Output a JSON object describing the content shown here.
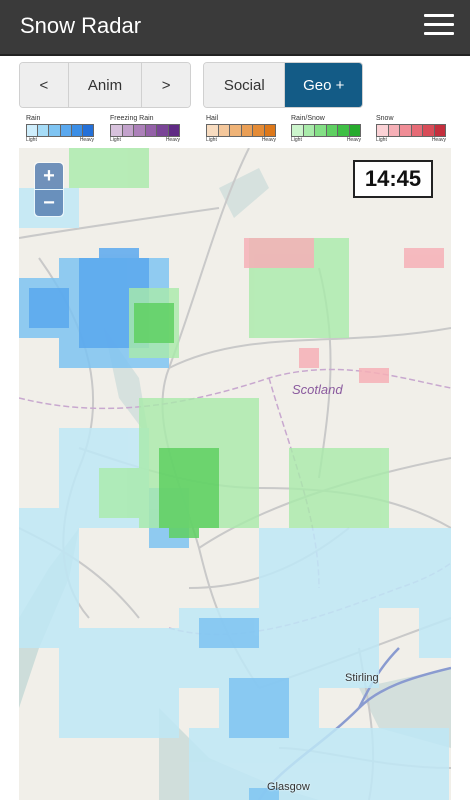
{
  "app": {
    "title": "Snow Radar"
  },
  "controls": {
    "prev_label": "<",
    "anim_label": "Anim",
    "next_label": ">",
    "social_label": "Social",
    "geo_label": "Geo +"
  },
  "legend": [
    {
      "name": "Rain",
      "light": "Light",
      "heavy": "Heavy",
      "colors": [
        "#cfeefc",
        "#a6dcf7",
        "#7fc4f2",
        "#5aa8ee",
        "#3b8ee6",
        "#2470d8"
      ]
    },
    {
      "name": "Freezing Rain",
      "light": "Light",
      "heavy": "Heavy",
      "colors": [
        "#d8c2dd",
        "#c3a2cc",
        "#ac80b9",
        "#9461a8",
        "#7a4597",
        "#5f2a84"
      ]
    },
    {
      "name": "Hail",
      "light": "Light",
      "heavy": "Heavy",
      "colors": [
        "#f8dcc0",
        "#f4c79b",
        "#efb377",
        "#ea9f56",
        "#e48b36",
        "#dd781a"
      ]
    },
    {
      "name": "Rain/Snow",
      "light": "Light",
      "heavy": "Heavy",
      "colors": [
        "#ccf5cc",
        "#a9ebaa",
        "#84df86",
        "#5fd062",
        "#3fbf45",
        "#27ab2d"
      ]
    },
    {
      "name": "Snow",
      "light": "Light",
      "heavy": "Heavy",
      "colors": [
        "#fbd2d6",
        "#f6b0b7",
        "#f08d96",
        "#e66b76",
        "#d84c58",
        "#c42f3d"
      ]
    }
  ],
  "map": {
    "zoom_in": "+",
    "zoom_out": "−",
    "time": "14:45",
    "region_label": "Scotland",
    "places": [
      "Stirling",
      "Glasgow"
    ],
    "colors": {
      "land": "#f1efe9",
      "roads": "#c9c9c9",
      "water": "#b5d0d0",
      "borders": "#c8a8cf",
      "rain": "#5aa8ee",
      "rainsnow": "#5fd062",
      "snow": "#f6b0b7",
      "lightrain": "#bfe8f6"
    }
  }
}
